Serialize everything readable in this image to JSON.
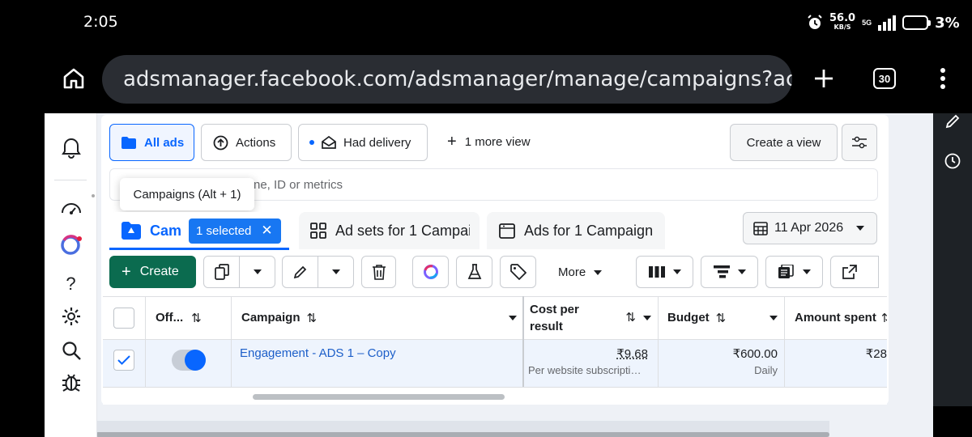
{
  "status_bar": {
    "time": "2:05",
    "net_speed": "56.0",
    "net_speed_unit": "KB/S",
    "network": "5G",
    "battery": "3%"
  },
  "browser": {
    "url": "adsmanager.facebook.com/adsmanager/manage/campaigns?act",
    "tab_count": "30"
  },
  "toolbar": {
    "all_ads": "All ads",
    "actions": "Actions",
    "had_delivery": "Had delivery",
    "more_view": "1 more view",
    "create_view": "Create a view"
  },
  "search": {
    "placeholder_fragment": "ne, ID or metrics",
    "tooltip": "Campaigns (Alt + 1)"
  },
  "tabs": {
    "campaigns": "Cam",
    "selected": "1 selected",
    "adsets": "Ad sets for 1 Campai",
    "ads": "Ads for 1 Campaign",
    "date": "11 Apr 2026"
  },
  "actions_row": {
    "create": "Create",
    "more": "More"
  },
  "table": {
    "headers": {
      "off": "Off...",
      "campaign": "Campaign",
      "cost_per_result_line1": "Cost per",
      "cost_per_result_line2": "result",
      "budget": "Budget",
      "amount_spent": "Amount spent"
    },
    "rows": [
      {
        "campaign": "Engagement - ADS 1 – Copy",
        "cost": "₹9.68",
        "cost_sub": "Per website subscripti…",
        "budget": "₹600.00",
        "budget_sub": "Daily",
        "amount": "₹28"
      }
    ]
  },
  "colors": {
    "accent": "#0866ff",
    "create_green": "#0b6b4f",
    "selected_blue": "#1877f2"
  }
}
